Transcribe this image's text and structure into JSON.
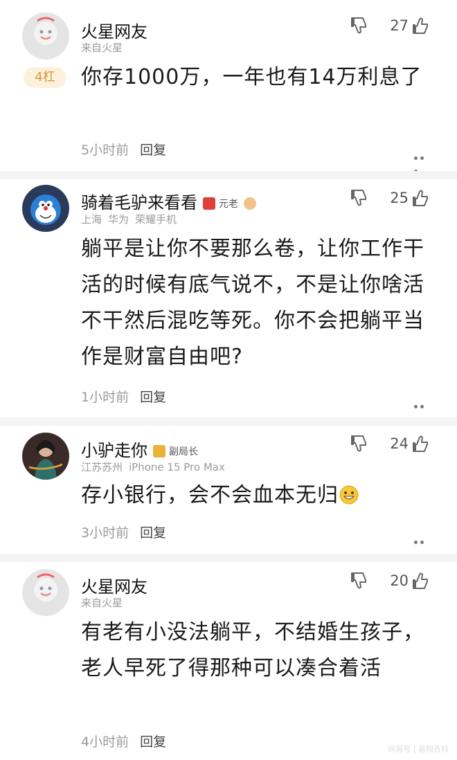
{
  "comments": [
    {
      "name": "火星网友",
      "subs": [
        "来自火星"
      ],
      "floor": "4杠",
      "count": "27",
      "text": "你存1000万，一年也有14万利息了",
      "time": "5小时前",
      "reply": "回复"
    },
    {
      "name": "骑着毛驴来看看",
      "badge": "元老",
      "subs": [
        "上海",
        "华为",
        "荣耀手机"
      ],
      "count": "25",
      "text": "躺平是让你不要那么卷，让你工作干活的时候有底气说不，不是让你啥活不干然后混吃等死。你不会把躺平当作是财富自由吧?",
      "time": "1小时前",
      "reply": "回复"
    },
    {
      "name": "小驴走你",
      "badge": "副局长",
      "subs": [
        "江苏苏州",
        "iPhone 15 Pro Max"
      ],
      "count": "24",
      "text": "存小银行，会不会血本无归",
      "time": "3小时前",
      "reply": "回复"
    },
    {
      "name": "火星网友",
      "subs": [
        "来自火星"
      ],
      "count": "20",
      "text": "有老有小没法躺平，不结婚生孩子，老人早死了得那种可以凑合着活",
      "time": "4小时前",
      "reply": "回复"
    }
  ],
  "icons": {
    "thumb_down": "thumb-down-icon",
    "thumb_up": "thumb-up-icon",
    "more": "more-dots-icon",
    "emoji": "grin-emoji-icon"
  },
  "colors": {
    "floor_bg": "#fdf1dc",
    "floor_text": "#d29a3a",
    "badge_red": "#e0403a",
    "badge_gold": "#e9b33a"
  },
  "watermark": "网易号 | 易翔百科"
}
